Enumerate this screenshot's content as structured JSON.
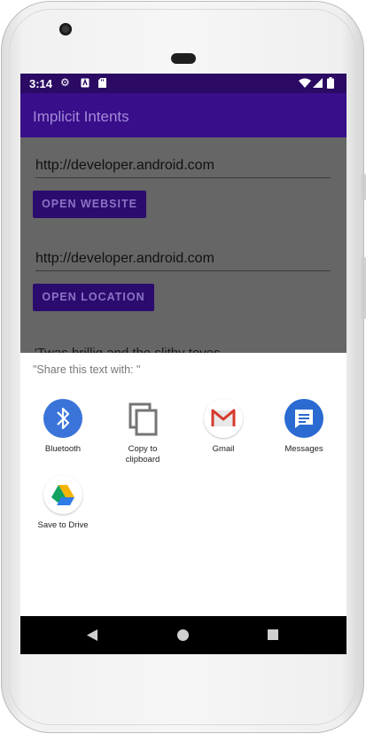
{
  "status_bar": {
    "time": "3:14"
  },
  "app": {
    "title": "Implicit Intents"
  },
  "fields": {
    "website_url": "http://developer.android.com",
    "location_url": "http://developer.android.com"
  },
  "buttons": {
    "open_website": "OPEN WEBSITE",
    "open_location": "OPEN LOCATION"
  },
  "partial_text": "'Twas brillig and the slithy toves",
  "share_sheet": {
    "title": "\"Share this text with: \"",
    "targets": [
      {
        "label": "Bluetooth",
        "icon": "bluetooth-icon"
      },
      {
        "label": "Copy to clipboard",
        "icon": "copy-icon"
      },
      {
        "label": "Gmail",
        "icon": "gmail-icon"
      },
      {
        "label": "Messages",
        "icon": "messages-icon"
      },
      {
        "label": "Save to Drive",
        "icon": "drive-icon"
      }
    ]
  },
  "colors": {
    "status_bar": "#2a0a63",
    "app_bar": "#380e8a",
    "button": "#2c0b6e",
    "scrim": "#666666"
  }
}
